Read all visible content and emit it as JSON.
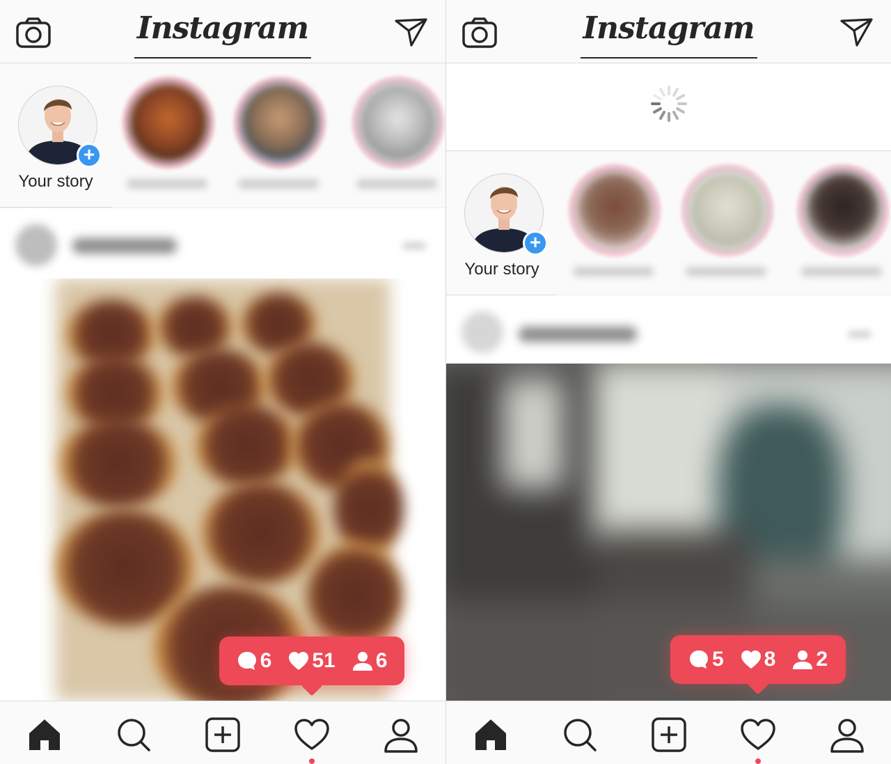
{
  "panels": [
    {
      "header": {
        "logo": "Instagram",
        "left_icon": "camera-icon",
        "right_icon": "direct-send-icon"
      },
      "own_story": {
        "label": "Your story",
        "add_icon": "plus-icon"
      },
      "stories_count_visible": 3,
      "notification": {
        "comments": "6",
        "likes": "51",
        "followers": "6"
      },
      "tabbar": [
        "home-icon",
        "search-icon",
        "add-post-icon",
        "activity-heart-icon",
        "profile-icon"
      ],
      "active_tab": "home"
    },
    {
      "header": {
        "logo": "Instagram",
        "left_icon": "camera-icon",
        "right_icon": "direct-send-icon"
      },
      "loading": true,
      "own_story": {
        "label": "Your story",
        "add_icon": "plus-icon"
      },
      "stories_count_visible": 3,
      "notification": {
        "comments": "5",
        "likes": "8",
        "followers": "2"
      },
      "tabbar": [
        "home-icon",
        "search-icon",
        "add-post-icon",
        "activity-heart-icon",
        "profile-icon"
      ],
      "active_tab": "home"
    }
  ],
  "colors": {
    "notification": "#ed4956",
    "badge": "#3897f0",
    "text": "#262626"
  }
}
